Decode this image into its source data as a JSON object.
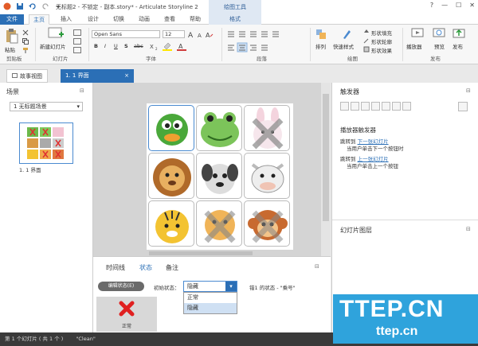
{
  "titlebar": {
    "title": "无标题2 - 不锁定 - 副本.story* - Articulate Storyline 2",
    "context_tab": "绘图工具",
    "controls": [
      "?",
      "—",
      "☐",
      "✕"
    ]
  },
  "tabs": {
    "file": "文件",
    "home": "主页",
    "insert": "插入",
    "design": "设计",
    "transitions": "切换",
    "animations": "动画",
    "view": "查看",
    "help": "帮助",
    "format": "格式"
  },
  "ribbon": {
    "clipboard": {
      "paste": "粘贴",
      "group": "剪贴板"
    },
    "slide": {
      "new": "新建幻灯片",
      "group": "幻灯片"
    },
    "font": {
      "family": "Open Sans",
      "size": "12",
      "group": "字体",
      "bold": "B",
      "italic": "I",
      "underline": "U",
      "strike": "abc",
      "shadow": "S"
    },
    "paragraph": {
      "group": "段落"
    },
    "drawing": {
      "arrange": "排列",
      "quick_styles": "快速样式",
      "fill": "形状填充",
      "outline": "形状轮廓",
      "effects": "形状效果",
      "group": "绘图"
    },
    "publish": {
      "player": "播放器",
      "preview": "预览",
      "publish": "发布",
      "group": "发布"
    }
  },
  "view_tabs": {
    "story": "故事视图",
    "slide": "1. 1 界面"
  },
  "scenes": {
    "title": "场景",
    "dropdown": "1 无标题场景",
    "thumb_label": "1. 1 界面"
  },
  "triggers": {
    "title": "触发器",
    "section": "播放器触发器",
    "items": [
      {
        "line1_prefix": "跳转到 ",
        "line1_link": "下一张幻灯片",
        "line2": "当用户单击下一个按钮时"
      },
      {
        "line1_prefix": "跳转到 ",
        "line1_link": "上一张幻灯片",
        "line2": "当用户单击上一个按钮"
      }
    ]
  },
  "layers": {
    "title": "幻灯片图层"
  },
  "bottom": {
    "tabs": [
      "时间线",
      "状态",
      "备注"
    ],
    "edit_states": "编辑状态(E)",
    "initial_state_label": "初始状态：",
    "initial_state_value": "隐藏",
    "options": [
      "正常",
      "隐藏"
    ],
    "state_info": "错1 的状态 - \"乘号\"",
    "state_thumb_label": "正常"
  },
  "status": {
    "slide_count": "第 1 个幻灯片 ( 共 1 个 )",
    "theme": "\"Clean\""
  },
  "watermark": {
    "big": "TTEP.CN",
    "small": "ttep.cn"
  }
}
